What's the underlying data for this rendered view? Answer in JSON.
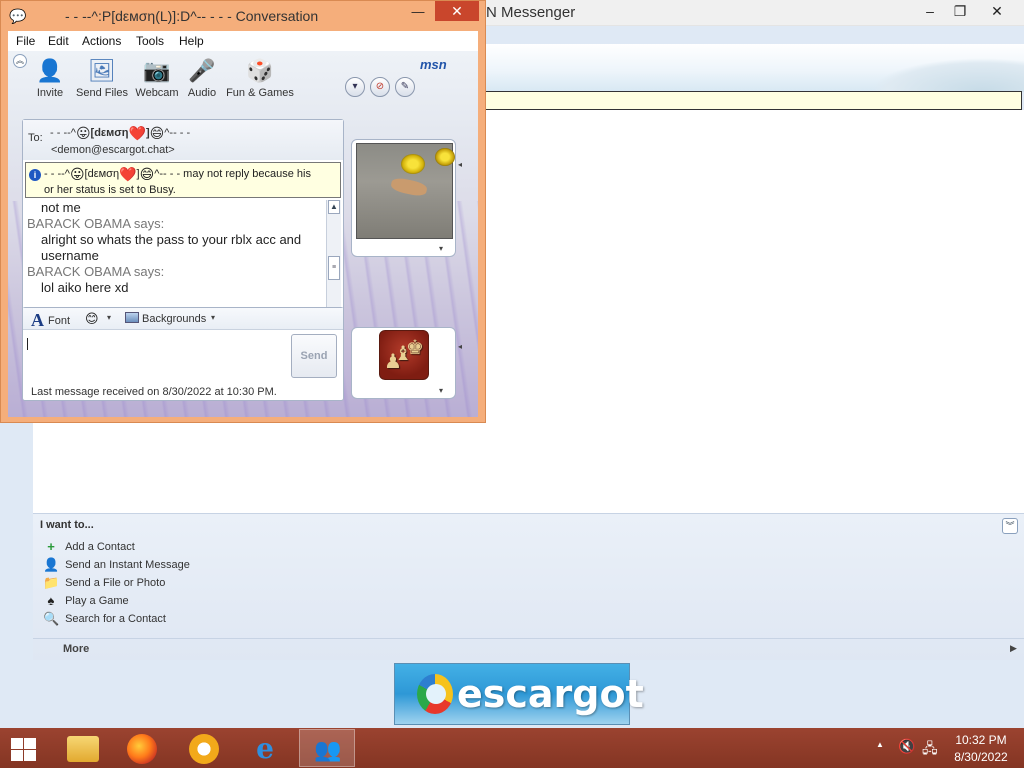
{
  "main_window": {
    "title": "N Messenger",
    "controls": {
      "minimize": "–",
      "maximize": "❐",
      "close": "✕"
    },
    "i_want_to": {
      "title": "I want to...",
      "tasks": [
        {
          "label": "Add a Contact",
          "icon": "add-contact-icon"
        },
        {
          "label": "Send an Instant Message",
          "icon": "instant-message-icon"
        },
        {
          "label": "Send a File or Photo",
          "icon": "send-file-icon"
        },
        {
          "label": "Play a Game",
          "icon": "game-icon"
        },
        {
          "label": "Search for a Contact",
          "icon": "search-contact-icon"
        }
      ],
      "more": "More"
    },
    "banner": {
      "text": "escargot"
    }
  },
  "conversation": {
    "title": "- - --^:P[ԁεмση(L)]:D^-- - - - Conversation",
    "close": "✕",
    "minimize": "—",
    "menu": [
      "File",
      "Edit",
      "Actions",
      "Tools",
      "Help"
    ],
    "toolbar": [
      {
        "label": "Invite",
        "icon": "invite-icon"
      },
      {
        "label": "Send Files",
        "icon": "send-files-icon"
      },
      {
        "label": "Webcam",
        "icon": "webcam-icon"
      },
      {
        "label": "Audio",
        "icon": "audio-icon"
      },
      {
        "label": "Fun & Games",
        "icon": "fun-games-icon"
      }
    ],
    "brand": "msn",
    "to": {
      "label": "To:",
      "name_prefix": "- - --^",
      "name_mid": "[ԁεмση",
      "name_close": "]",
      "name_suffix": "^-- - -",
      "email": "<demon@escargot.chat>"
    },
    "busy_notice": {
      "part1": "- - --^",
      "part2": "[ԁεмση",
      "part3": "]",
      "part4": "^-- - - may not reply because his",
      "line2": "or her status is set to Busy."
    },
    "messages": [
      {
        "type": "text",
        "text": "not me"
      },
      {
        "type": "sender",
        "text": "BARACK OBAMA says:"
      },
      {
        "type": "text",
        "text": "alright so whats the pass to your rblx acc and"
      },
      {
        "type": "text",
        "text": "username"
      },
      {
        "type": "sender",
        "text": "BARACK OBAMA says:"
      },
      {
        "type": "text",
        "text": "lol aiko here xd"
      }
    ],
    "format_bar": {
      "font": "Font",
      "font_glyph": "A",
      "backgrounds": "Backgrounds"
    },
    "send": "Send",
    "status": "Last message received on 8/30/2022 at 10:30 PM."
  },
  "taskbar": {
    "apps": [
      {
        "name": "file-explorer",
        "active": false
      },
      {
        "name": "firefox",
        "active": false
      },
      {
        "name": "chrome",
        "active": false
      },
      {
        "name": "internet-explorer",
        "active": false
      },
      {
        "name": "msn-messenger",
        "active": true
      }
    ],
    "clock": {
      "time": "10:32 PM",
      "date": "8/30/2022"
    }
  }
}
